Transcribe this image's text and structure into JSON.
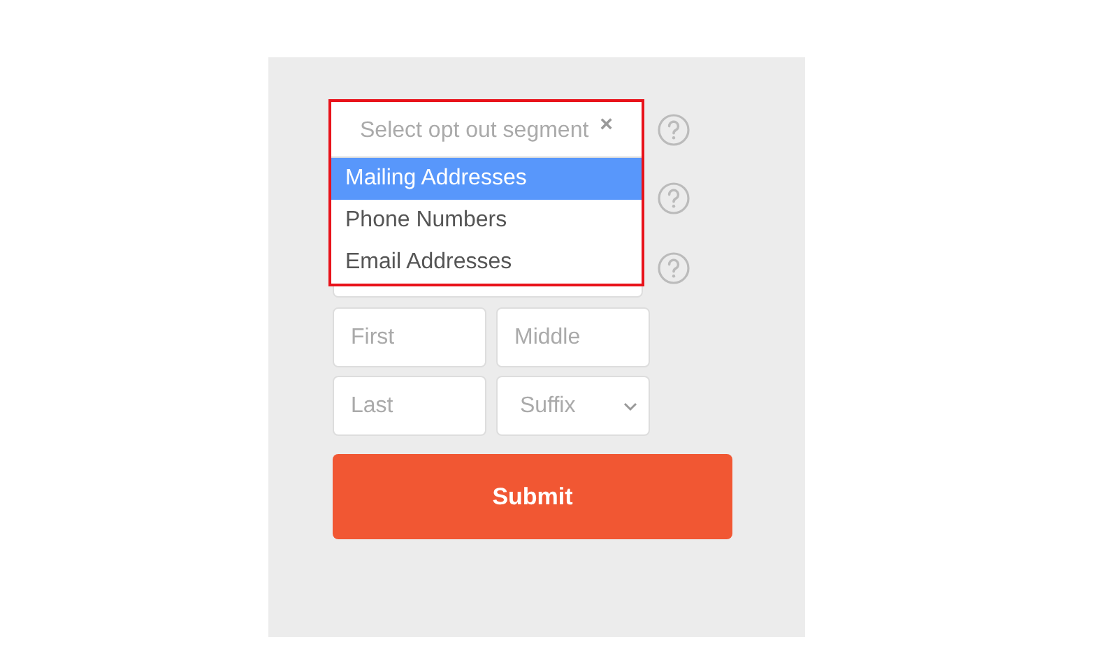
{
  "dropdown": {
    "placeholder": "Select opt out segment",
    "clear": "×",
    "options": [
      {
        "label": "Mailing Addresses",
        "selected": true
      },
      {
        "label": "Phone Numbers",
        "selected": false
      },
      {
        "label": "Email Addresses",
        "selected": false
      }
    ]
  },
  "name_fields": [
    {
      "kind": "input",
      "placeholder": "First"
    },
    {
      "kind": "input",
      "placeholder": "Middle"
    },
    {
      "kind": "input",
      "placeholder": "Last"
    },
    {
      "kind": "select",
      "placeholder": "Suffix"
    }
  ],
  "submit": "Submit"
}
